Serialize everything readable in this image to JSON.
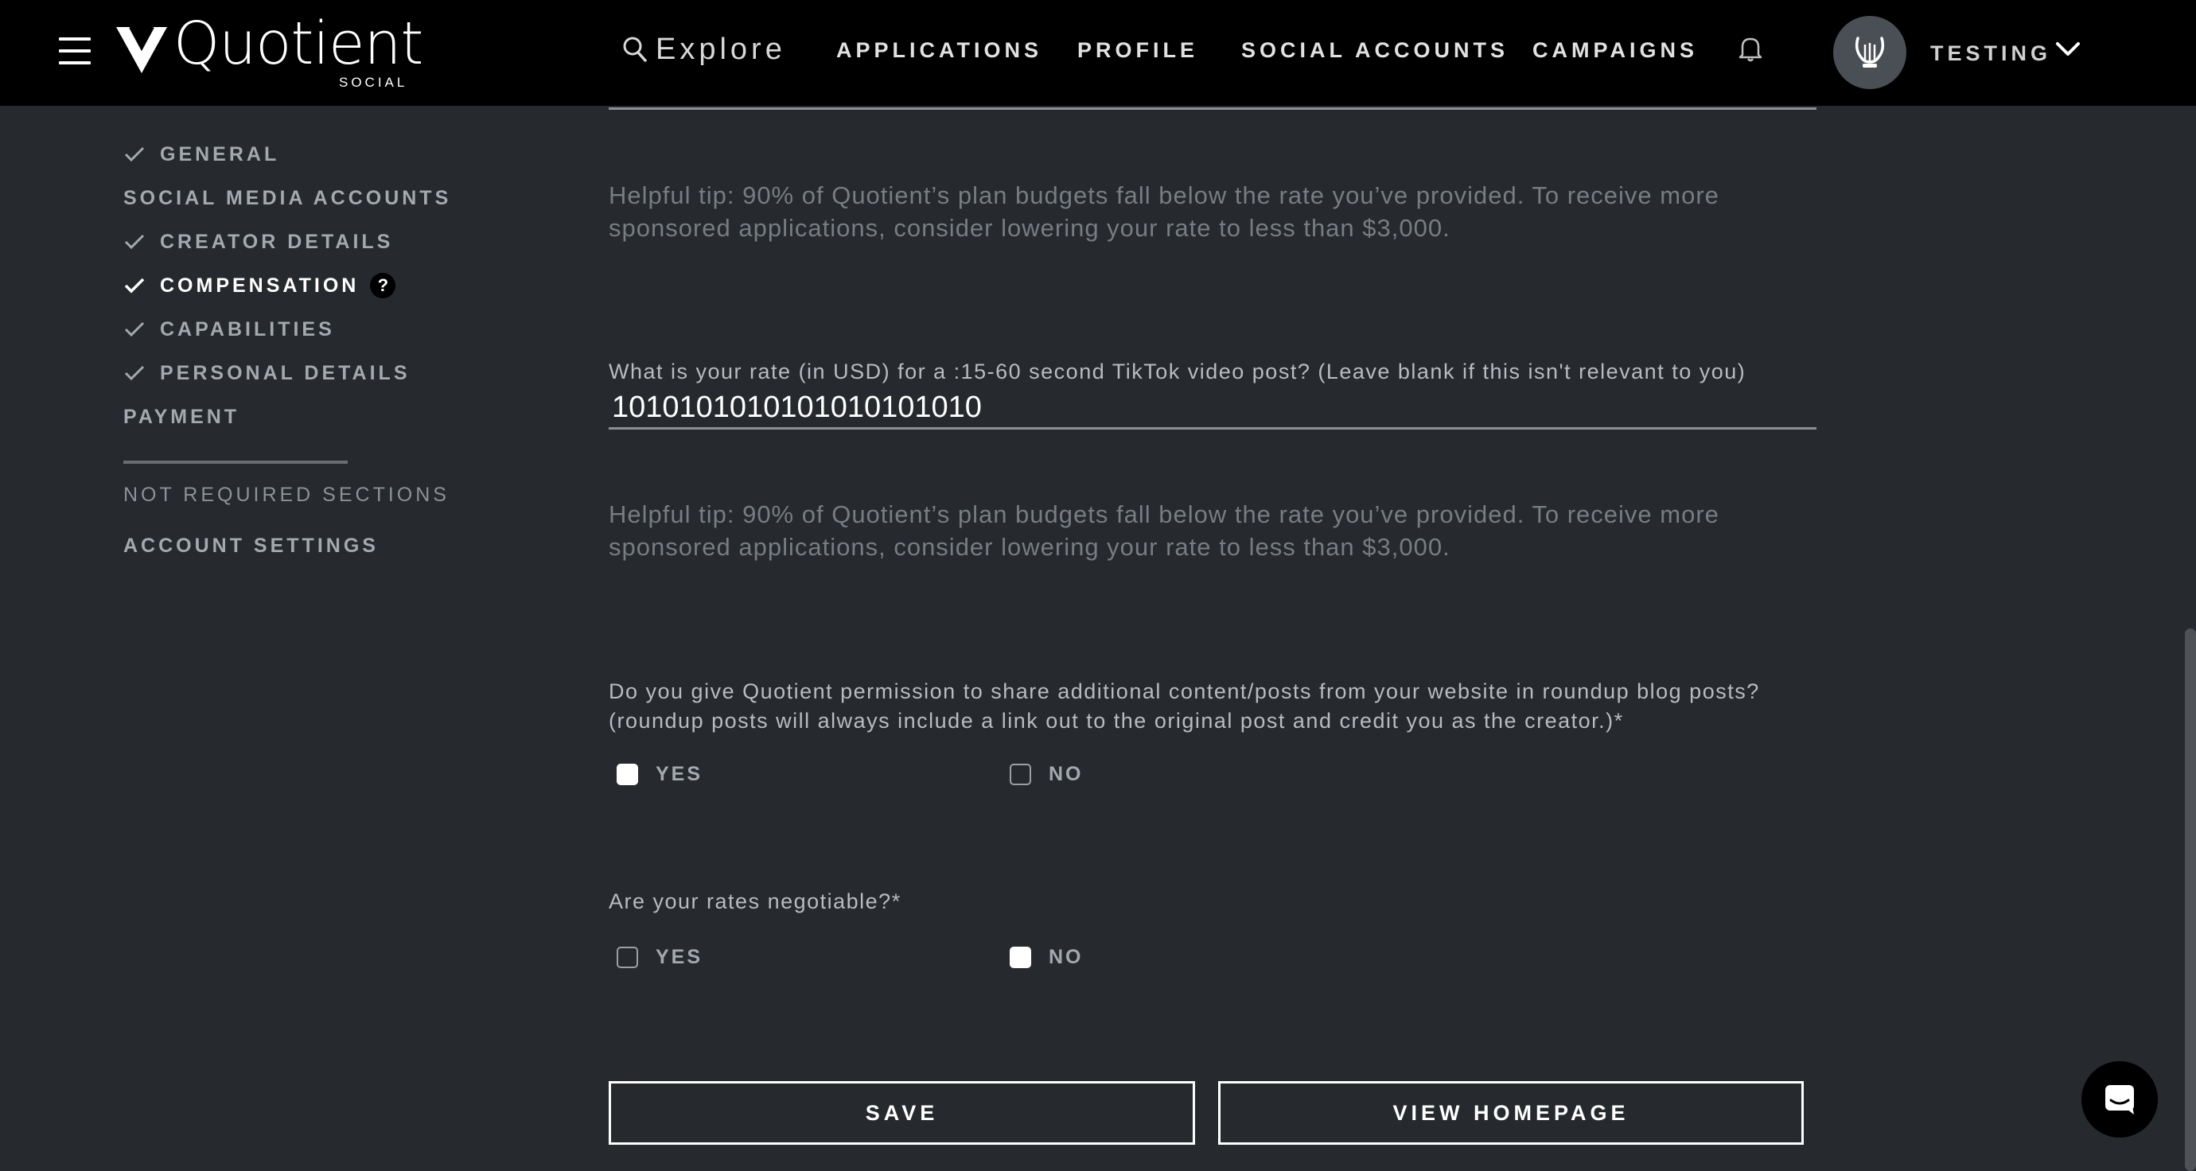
{
  "header": {
    "logo_text": "Quotient",
    "logo_subtext": "SOCIAL",
    "explore_label": "Explore",
    "nav": [
      "APPLICATIONS",
      "PROFILE",
      "SOCIAL ACCOUNTS",
      "CAMPAIGNS"
    ],
    "user_name": "TESTING"
  },
  "sidebar": {
    "items": [
      {
        "label": "GENERAL",
        "checked": true
      },
      {
        "label": "SOCIAL MEDIA ACCOUNTS",
        "checked": false
      },
      {
        "label": "CREATOR DETAILS",
        "checked": true
      },
      {
        "label": "COMPENSATION",
        "checked": true,
        "active": true,
        "help": "?"
      },
      {
        "label": "CAPABILITIES",
        "checked": true
      },
      {
        "label": "PERSONAL DETAILS",
        "checked": true
      },
      {
        "label": "PAYMENT",
        "checked": false
      }
    ],
    "not_required_label": "NOT REQUIRED SECTIONS",
    "account_settings_label": "ACCOUNT SETTINGS"
  },
  "form": {
    "tip_1": "Helpful tip: 90% of Quotient’s plan budgets fall below the rate you’ve provided. To receive more sponsored applications, consider lowering your rate to less than $3,000.",
    "tiktok_label": "What is your rate (in USD) for a :15-60 second TikTok video post? (Leave blank if this isn't relevant to you)",
    "tiktok_value": "1010101010101010101010",
    "tip_2": "Helpful tip: 90% of Quotient’s plan budgets fall below the rate you’ve provided. To receive more sponsored applications, consider lowering your rate to less than $3,000.",
    "permission_question_line1": "Do you give Quotient permission to share additional content/posts from your website in roundup blog posts?",
    "permission_question_line2": "(roundup posts will always include a link out to the original post and credit you as the creator.)*",
    "permission_yes": {
      "label": "YES",
      "checked": true
    },
    "permission_no": {
      "label": "NO",
      "checked": false
    },
    "negotiable_question": "Are your rates negotiable?*",
    "negotiable_yes": {
      "label": "YES",
      "checked": false
    },
    "negotiable_no": {
      "label": "NO",
      "checked": true
    },
    "save_label": "SAVE",
    "homepage_label": "VIEW HOMEPAGE"
  },
  "colors": {
    "background": "#26292e",
    "topbar": "#000000",
    "accent": "#ffffff"
  }
}
